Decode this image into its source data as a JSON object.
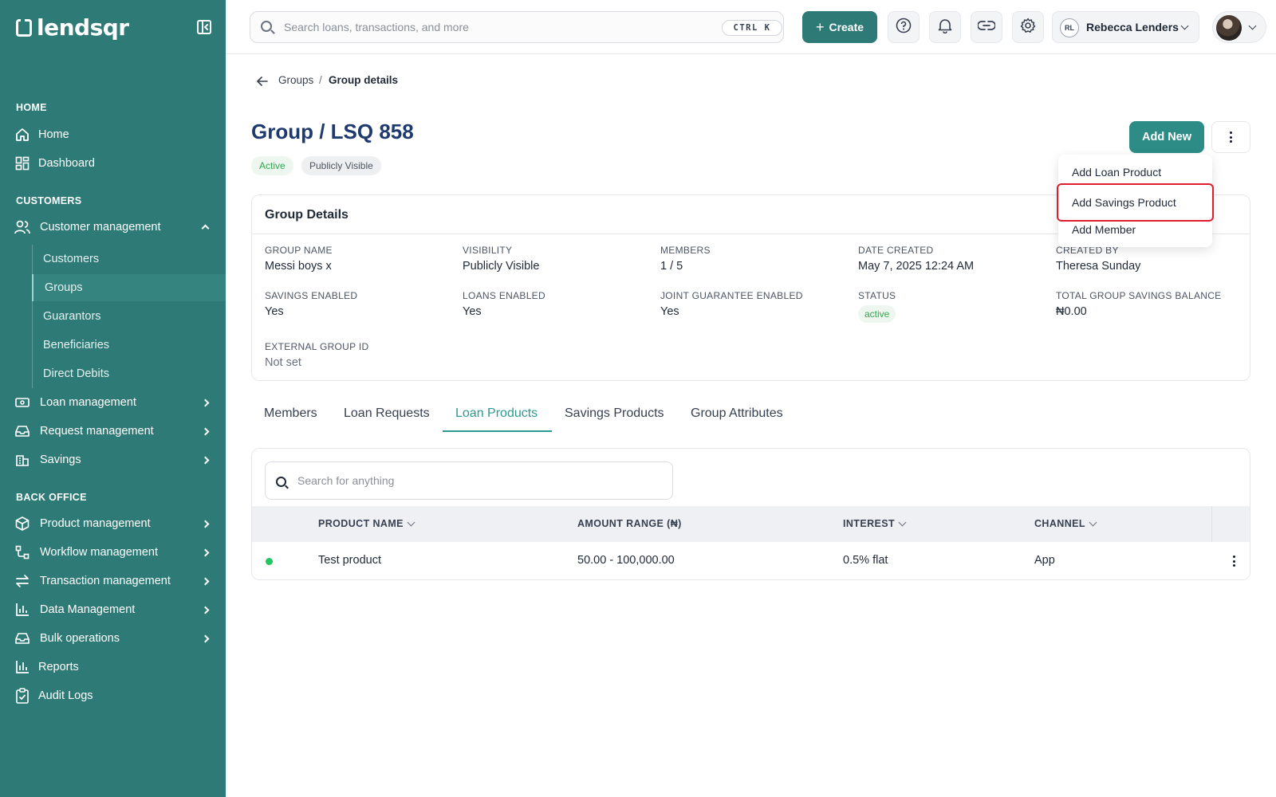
{
  "app": {
    "brand": "lendsqr",
    "accent": "#2d7a77"
  },
  "sidebar": {
    "sections": {
      "home": "HOME",
      "customers": "CUSTOMERS",
      "back_office": "BACK OFFICE"
    },
    "home_items": [
      {
        "label": "Home",
        "icon": "home-icon"
      },
      {
        "label": "Dashboard",
        "icon": "dashboard-icon"
      }
    ],
    "customer_management": {
      "label": "Customer management",
      "children": [
        "Customers",
        "Groups",
        "Guarantors",
        "Beneficiaries",
        "Direct Debits"
      ],
      "active_child": "Groups"
    },
    "customer_items": [
      {
        "label": "Loan management"
      },
      {
        "label": "Request management"
      },
      {
        "label": "Savings"
      }
    ],
    "back_office_items": [
      {
        "label": "Product management"
      },
      {
        "label": "Workflow management"
      },
      {
        "label": "Transaction management"
      },
      {
        "label": "Data Management"
      },
      {
        "label": "Bulk operations"
      },
      {
        "label": "Reports"
      },
      {
        "label": "Audit Logs"
      }
    ]
  },
  "topbar": {
    "search_placeholder": "Search loans, transactions, and more",
    "shortcut": "CTRL K",
    "create_label": "Create",
    "user_initials": "RL",
    "user_name": "Rebecca Lenders"
  },
  "breadcrumb": {
    "parent": "Groups",
    "separator": "/",
    "current": "Group details"
  },
  "page": {
    "title": "Group / LSQ 858",
    "badges": {
      "status": "Active",
      "visibility": "Publicly Visible"
    },
    "add_new_label": "Add New"
  },
  "dropdown": {
    "items": [
      "Add Loan Product",
      "Add Savings Product",
      "Add Member"
    ],
    "highlighted": "Add Savings Product"
  },
  "group_details": {
    "title": "Group Details",
    "fields": {
      "group_name": {
        "label": "GROUP NAME",
        "value": "Messi boys x"
      },
      "visibility": {
        "label": "VISIBILITY",
        "value": "Publicly Visible"
      },
      "members": {
        "label": "MEMBERS",
        "value": "1 / 5"
      },
      "date_created": {
        "label": "DATE CREATED",
        "value": "May 7, 2025 12:24 AM"
      },
      "created_by": {
        "label": "CREATED BY",
        "value": "Theresa Sunday"
      },
      "savings_enabled": {
        "label": "SAVINGS ENABLED",
        "value": "Yes"
      },
      "loans_enabled": {
        "label": "LOANS ENABLED",
        "value": "Yes"
      },
      "joint_guarantee": {
        "label": "JOINT GUARANTEE ENABLED",
        "value": "Yes"
      },
      "status": {
        "label": "STATUS",
        "value": "active"
      },
      "total_savings": {
        "label": "TOTAL GROUP SAVINGS BALANCE",
        "value": "₦0.00"
      },
      "external_id": {
        "label": "EXTERNAL GROUP ID",
        "value": "Not set"
      }
    }
  },
  "tabs": [
    "Members",
    "Loan Requests",
    "Loan Products",
    "Savings Products",
    "Group Attributes"
  ],
  "active_tab": "Loan Products",
  "table": {
    "search_placeholder": "Search for anything",
    "columns": [
      "PRODUCT NAME",
      "AMOUNT RANGE (₦)",
      "INTEREST",
      "CHANNEL"
    ],
    "rows": [
      {
        "product_name": "Test product",
        "amount_range": "50.00 - 100,000.00",
        "interest": "0.5% flat",
        "channel": "App",
        "status_color": "#22c55e"
      }
    ]
  }
}
